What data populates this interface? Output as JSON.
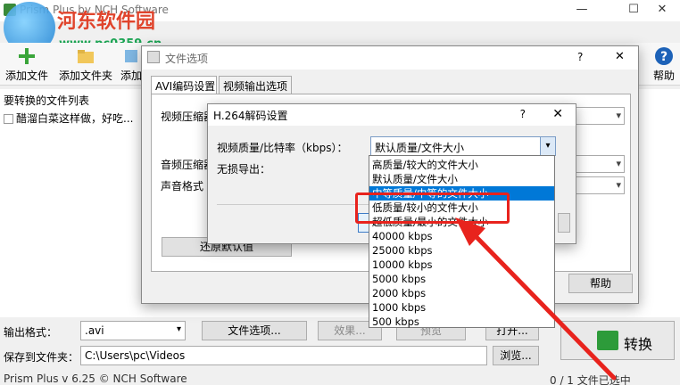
{
  "window": {
    "title": "Prism Plus by NCH Software",
    "controls": [
      "—",
      "☐",
      "✕"
    ]
  },
  "watermark": {
    "title": "河东软件园",
    "url": "www.pc0359.cn"
  },
  "toolbar": {
    "items": [
      "添加文件",
      "添加文件夹",
      "添加"
    ],
    "help_label": "帮助"
  },
  "file_list": {
    "header": "要转换的文件列表",
    "rows": [
      "醋溜白菜这样做，好吃..."
    ]
  },
  "bottom": {
    "output_format_label": "输出格式：",
    "output_format_value": ".avi",
    "file_options_button": "文件选项...",
    "effects_button": "效果...",
    "preview_button": "预览",
    "open_button": "打开...",
    "save_to_label": "保存到文件夹：",
    "save_to_value": "C:\\Users\\pc\\Videos",
    "browse_button": "浏览...",
    "convert_button": "转换"
  },
  "statusbar": {
    "left": "Prism Plus v 6.25 © NCH Software",
    "right": "0 / 1 文件已选中"
  },
  "file_options_dialog": {
    "title": "文件选项",
    "help_symbol": "?",
    "close_symbol": "✕",
    "tabs": [
      "AVI编码设置",
      "视频输出选项"
    ],
    "video_label": "视频压缩器",
    "audio_label": "音频压缩器",
    "sound_label": "声音格式",
    "restore_button": "还原默认值",
    "help_button": "帮助"
  },
  "h264_dialog": {
    "title": "H.264解码设置",
    "help_symbol": "?",
    "close_symbol": "✕",
    "quality_label": "视频质量/比特率（kbps）：",
    "lossless_label": "无损导出：",
    "selected_value": "默认质量/文件大小"
  },
  "dropdown": {
    "options": [
      "高质量/较大的文件大小",
      "默认质量/文件大小",
      "中等质量/中等的文件大小",
      "低质量/较小的文件大小",
      "超低质量/最小的文件大小",
      "40000 kbps",
      "25000 kbps",
      "10000 kbps",
      "5000 kbps",
      "2000 kbps",
      "1000 kbps",
      "500 kbps"
    ],
    "selected_index": 2
  },
  "colors": {
    "annotation": "#e8231d",
    "selection": "#0078d7",
    "convert_icon": "#2d9b3a"
  }
}
